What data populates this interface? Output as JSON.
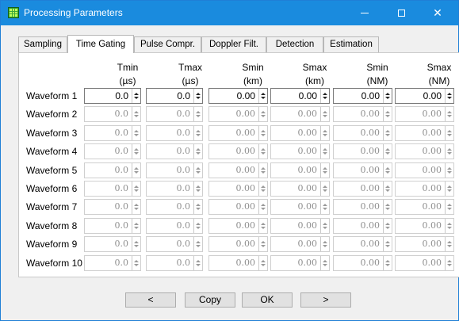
{
  "window": {
    "title": "Processing Parameters"
  },
  "tabs": [
    "Sampling",
    "Time Gating",
    "Pulse Compr.",
    "Doppler Filt.",
    "Detection",
    "Estimation"
  ],
  "active_tab": "Time Gating",
  "columns": [
    {
      "name": "Tmin",
      "unit": "(µs)"
    },
    {
      "name": "Tmax",
      "unit": "(µs)"
    },
    {
      "name": "Smin",
      "unit": "(km)"
    },
    {
      "name": "Smax",
      "unit": "(km)"
    },
    {
      "name": "Smin",
      "unit": "(NM)"
    },
    {
      "name": "Smax",
      "unit": "(NM)"
    }
  ],
  "rows": [
    {
      "label": "Waveform 1",
      "enabled": true,
      "values": [
        "0.0",
        "0.0",
        "0.00",
        "0.00",
        "0.00",
        "0.00"
      ]
    },
    {
      "label": "Waveform 2",
      "enabled": false,
      "values": [
        "0.0",
        "0.0",
        "0.00",
        "0.00",
        "0.00",
        "0.00"
      ]
    },
    {
      "label": "Waveform 3",
      "enabled": false,
      "values": [
        "0.0",
        "0.0",
        "0.00",
        "0.00",
        "0.00",
        "0.00"
      ]
    },
    {
      "label": "Waveform 4",
      "enabled": false,
      "values": [
        "0.0",
        "0.0",
        "0.00",
        "0.00",
        "0.00",
        "0.00"
      ]
    },
    {
      "label": "Waveform 5",
      "enabled": false,
      "values": [
        "0.0",
        "0.0",
        "0.00",
        "0.00",
        "0.00",
        "0.00"
      ]
    },
    {
      "label": "Waveform 6",
      "enabled": false,
      "values": [
        "0.0",
        "0.0",
        "0.00",
        "0.00",
        "0.00",
        "0.00"
      ]
    },
    {
      "label": "Waveform 7",
      "enabled": false,
      "values": [
        "0.0",
        "0.0",
        "0.00",
        "0.00",
        "0.00",
        "0.00"
      ]
    },
    {
      "label": "Waveform 8",
      "enabled": false,
      "values": [
        "0.0",
        "0.0",
        "0.00",
        "0.00",
        "0.00",
        "0.00"
      ]
    },
    {
      "label": "Waveform 9",
      "enabled": false,
      "values": [
        "0.0",
        "0.0",
        "0.00",
        "0.00",
        "0.00",
        "0.00"
      ]
    },
    {
      "label": "Waveform 10",
      "enabled": false,
      "values": [
        "0.0",
        "0.0",
        "0.00",
        "0.00",
        "0.00",
        "0.00"
      ]
    }
  ],
  "buttons": {
    "prev": "<",
    "copy": "Copy",
    "ok": "OK",
    "next": ">"
  },
  "colors": {
    "titlebar": "#1a8bde",
    "accent": "#1f7fd6"
  }
}
